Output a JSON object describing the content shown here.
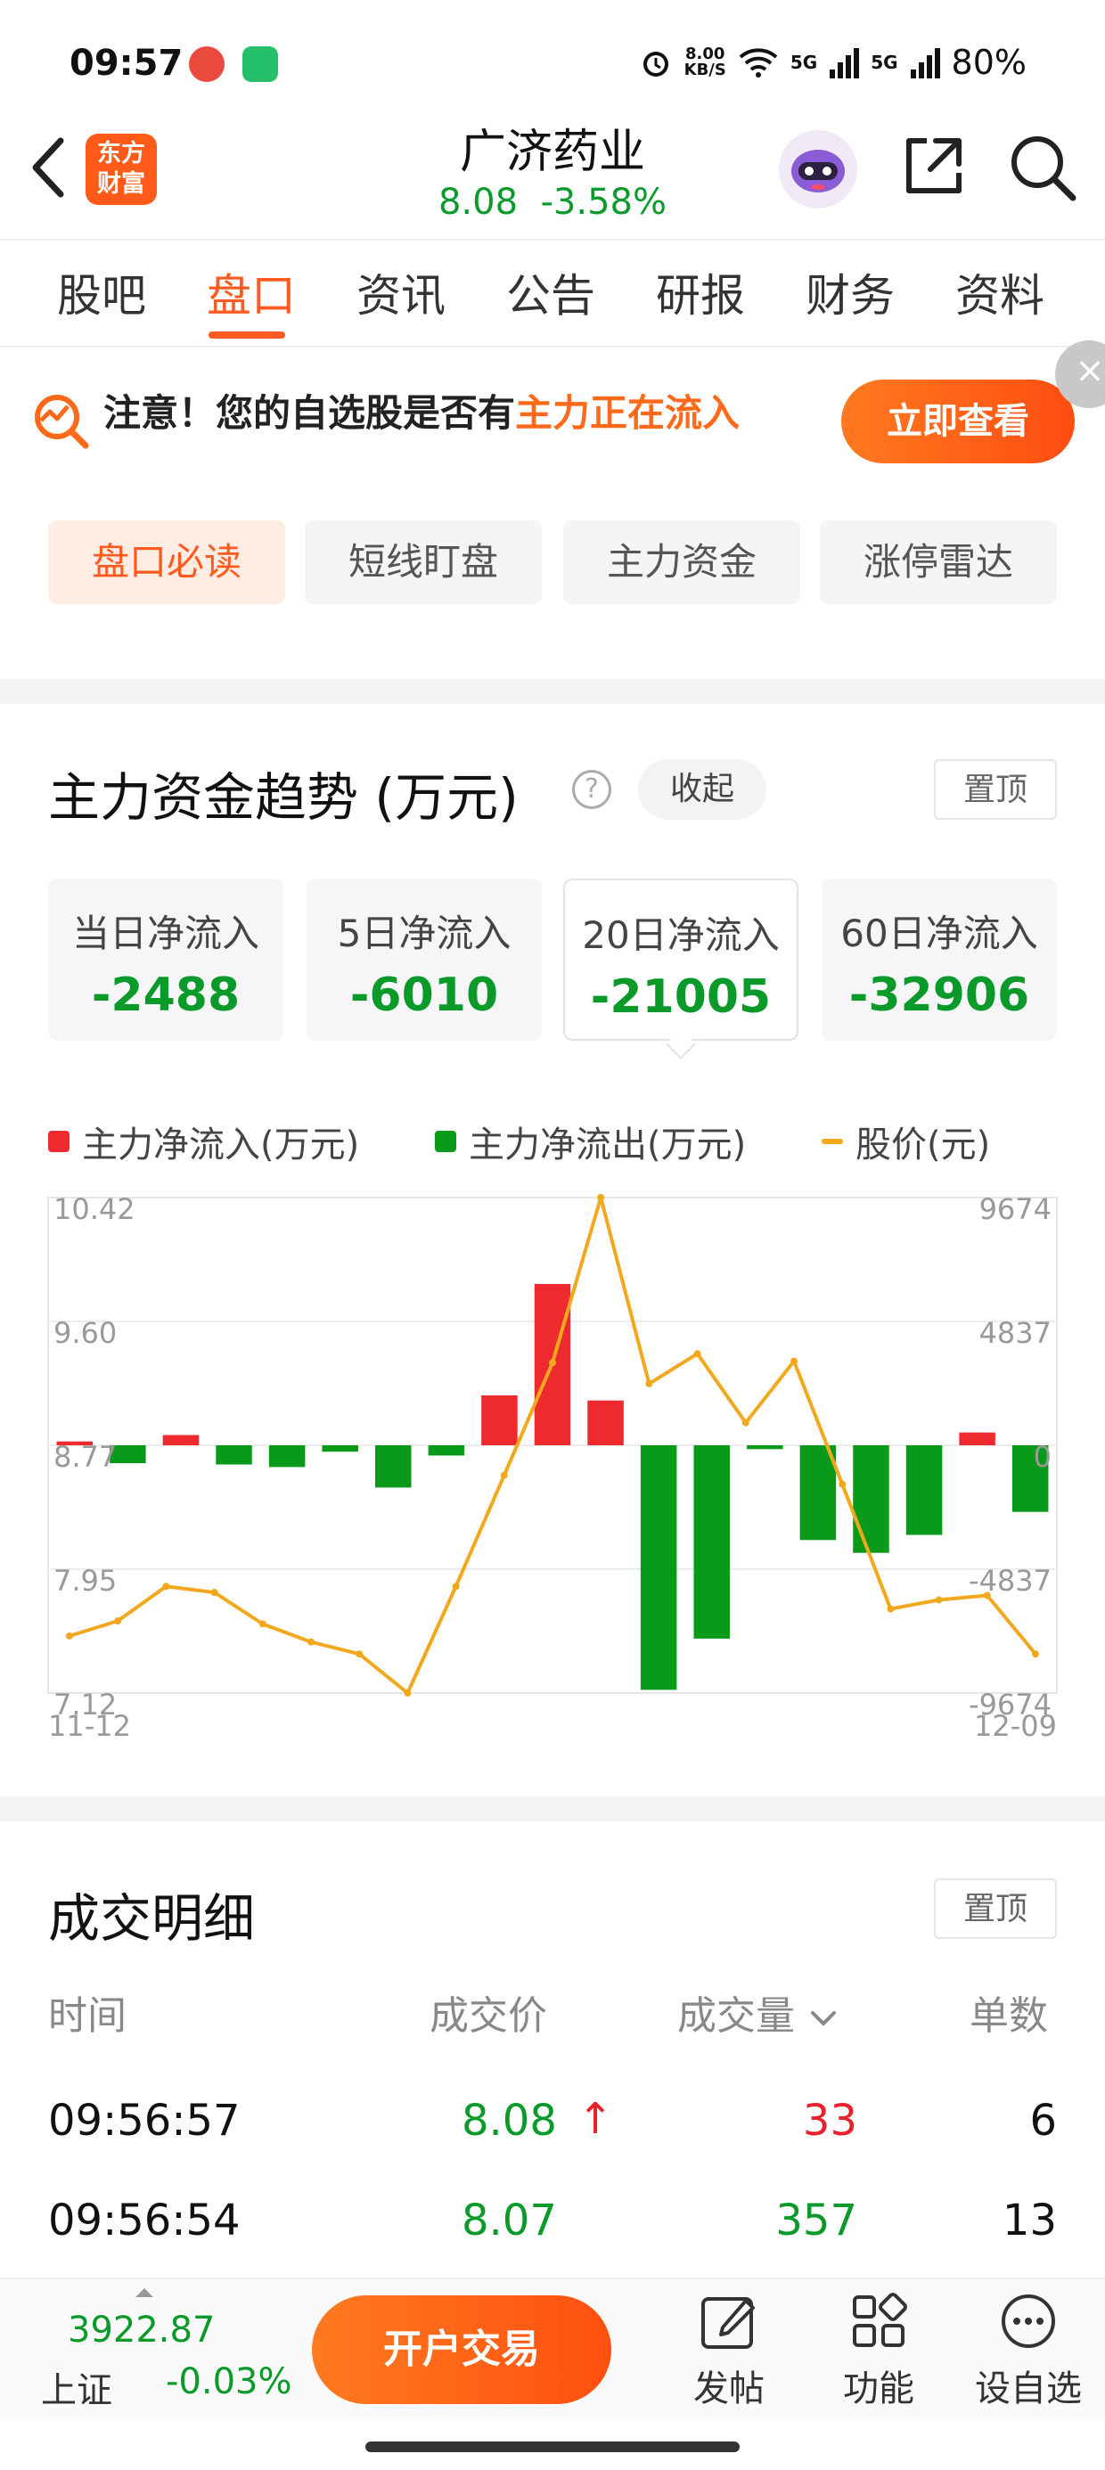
{
  "status_bar": {
    "time": "09:57",
    "net_speed_value": "8.00",
    "net_speed_unit": "KB/S",
    "network": "5G",
    "battery": "80%",
    "icons": [
      "alarm-icon",
      "wifi-icon",
      "signal-icon",
      "signal-icon"
    ]
  },
  "header": {
    "logo_text_line1": "东方",
    "logo_text_line2": "财富",
    "stock_name": "广济药业",
    "price": "8.08",
    "change_pct": "-3.58%",
    "icons": [
      "back-icon",
      "robot-icon",
      "share-icon",
      "search-icon"
    ]
  },
  "tabs": [
    {
      "label": "股吧",
      "active": false
    },
    {
      "label": "盘口",
      "active": true
    },
    {
      "label": "资讯",
      "active": false
    },
    {
      "label": "公告",
      "active": false
    },
    {
      "label": "研报",
      "active": false
    },
    {
      "label": "财务",
      "active": false
    },
    {
      "label": "资料",
      "active": false
    }
  ],
  "notice": {
    "prefix": "注意！您的自选股是否有",
    "highlight": "主力正在流入",
    "button": "立即查看"
  },
  "subtabs": [
    {
      "label": "盘口必读",
      "active": true
    },
    {
      "label": "短线盯盘",
      "active": false
    },
    {
      "label": "主力资金",
      "active": false
    },
    {
      "label": "涨停雷达",
      "active": false
    }
  ],
  "fund_section": {
    "title": "主力资金趋势 (万元)",
    "collapse_label": "收起",
    "pin_label": "置顶",
    "cards": [
      {
        "label": "当日净流入",
        "value": "-2488",
        "active": false
      },
      {
        "label": "5日净流入",
        "value": "-6010",
        "active": false
      },
      {
        "label": "20日净流入",
        "value": "-21005",
        "active": true
      },
      {
        "label": "60日净流入",
        "value": "-32906",
        "active": false
      }
    ],
    "legend": [
      {
        "label": "主力净流入(万元)",
        "color": "#ee2a2f"
      },
      {
        "label": "主力净流出(万元)",
        "color": "#0a9a1a"
      },
      {
        "label": "股价(元)",
        "color": "#f2a81d"
      }
    ]
  },
  "chart_data": {
    "type": "bar+line",
    "x_start": "11-12",
    "x_end": "12-09",
    "left_ticks": [
      "10.42",
      "9.60",
      "8.77",
      "7.95",
      "7.12"
    ],
    "right_ticks": [
      "9674",
      "4837",
      "0",
      "-4837",
      "-9674"
    ],
    "price_range": [
      7.12,
      10.42
    ],
    "flow_range": [
      -9674,
      9674
    ],
    "flows": [
      150,
      -700,
      400,
      -750,
      -850,
      -250,
      -1650,
      -400,
      1950,
      6300,
      1750,
      -9550,
      -7550,
      -150,
      -3700,
      -4200,
      -3500,
      500,
      -2600
    ],
    "prices": [
      7.5,
      7.6,
      7.83,
      7.79,
      7.58,
      7.46,
      7.38,
      7.12,
      7.83,
      8.57,
      9.32,
      10.42,
      9.18,
      9.38,
      8.92,
      9.33,
      8.51,
      7.68,
      7.74,
      7.77,
      7.38
    ],
    "grid": true
  },
  "trade_section": {
    "title": "成交明细",
    "pin_label": "置顶",
    "headers": {
      "time": "时间",
      "price": "成交价",
      "volume": "成交量",
      "count": "单数"
    },
    "rows": [
      {
        "time": "09:56:57",
        "price": "8.08",
        "arrow": "↑",
        "volume": "33",
        "count": "6",
        "volume_color": "red"
      },
      {
        "time": "09:56:54",
        "price": "8.07",
        "arrow": "",
        "volume": "357",
        "count": "13",
        "volume_color": "green"
      }
    ]
  },
  "bottom_bar": {
    "index_value": "3922.87",
    "index_name": "上证",
    "index_change": "-0.03%",
    "trade_button": "开户交易",
    "tools": [
      {
        "label": "发帖",
        "icon": "post-icon"
      },
      {
        "label": "功能",
        "icon": "grid-icon"
      },
      {
        "label": "设自选",
        "icon": "more-icon"
      }
    ]
  }
}
